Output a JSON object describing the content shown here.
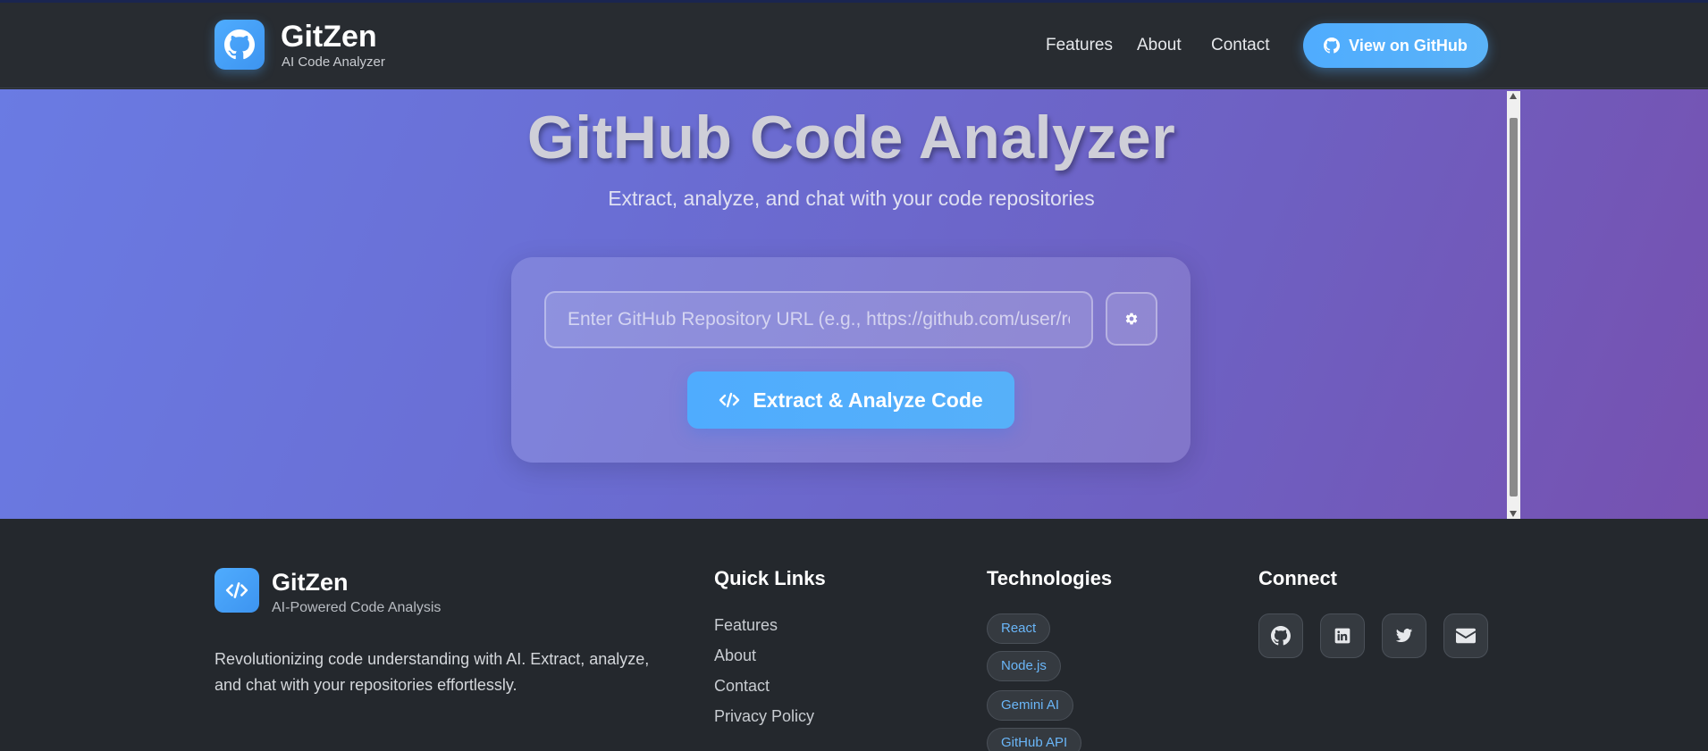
{
  "header": {
    "brand_name": "GitZen",
    "brand_sub": "AI Code Analyzer",
    "nav": [
      "Features",
      "About",
      "Contact"
    ],
    "github_button": "View on GitHub"
  },
  "hero": {
    "title": "GitHub Code Analyzer",
    "subtitle": "Extract, analyze, and chat with your code repositories",
    "url_placeholder": "Enter GitHub Repository URL (e.g., https://github.com/user/repo)",
    "url_value": "",
    "extract_button": "Extract & Analyze Code"
  },
  "footer": {
    "brand_name": "GitZen",
    "brand_sub": "AI-Powered Code Analysis",
    "description": "Revolutionizing code understanding with AI. Extract, analyze, and chat with your repositories effortlessly.",
    "quick_links_title": "Quick Links",
    "quick_links": [
      "Features",
      "About",
      "Contact",
      "Privacy Policy"
    ],
    "technologies_title": "Technologies",
    "technologies": [
      "React",
      "Node.js",
      "Gemini AI",
      "GitHub API"
    ],
    "connect_title": "Connect",
    "social_icons": [
      "github-icon",
      "linkedin-icon",
      "twitter-icon",
      "envelope-icon"
    ]
  },
  "colors": {
    "accent": "#4facfe",
    "header_bg": "#282c31",
    "footer_bg": "#24282d",
    "hero_gradient_start": "#6a7be3",
    "hero_gradient_end": "#7651b0"
  }
}
